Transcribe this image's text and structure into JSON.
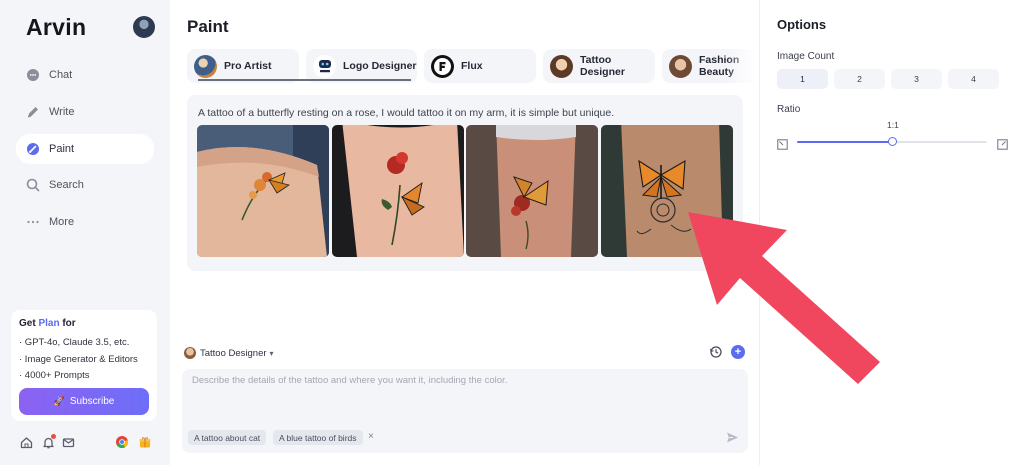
{
  "sidebar": {
    "brand": "Arvin",
    "nav": [
      {
        "label": "Chat",
        "icon": "chat-icon"
      },
      {
        "label": "Write",
        "icon": "write-icon"
      },
      {
        "label": "Paint",
        "icon": "paint-icon",
        "active": true
      },
      {
        "label": "Search",
        "icon": "search-icon"
      },
      {
        "label": "More",
        "icon": "more-icon"
      }
    ],
    "plan": {
      "title_prefix": "Get ",
      "title_accent": "Plan",
      "title_suffix": " for",
      "lines": [
        "· GPT-4o, Claude 3.5, etc.",
        "· Image Generator & Editors",
        "· 4000+ Prompts"
      ],
      "subscribe_label": "Subscribe"
    },
    "bottom_icons": [
      "home-icon",
      "notification-icon",
      "mail-icon",
      "chrome-icon",
      "gift-icon"
    ]
  },
  "main": {
    "title": "Paint",
    "tabs": [
      {
        "label": "Pro Artist"
      },
      {
        "label": "Logo Designer",
        "active": true
      },
      {
        "label": "Flux"
      },
      {
        "label": "Tattoo Designer"
      },
      {
        "label": "Fashion Beauty"
      }
    ],
    "result": {
      "prompt": "A tattoo of a butterfly resting on a rose, I would tattoo it on my arm, it is simple but unique.",
      "images": [
        "tattoo-image-1",
        "tattoo-image-2",
        "tattoo-image-3",
        "tattoo-image-4"
      ]
    },
    "composer": {
      "style": "Tattoo Designer",
      "placeholder": "Describe the details of the tattoo and where you want it, including the color.",
      "suggestions": [
        "A tattoo about cat",
        "A blue tattoo of birds"
      ]
    }
  },
  "options": {
    "title": "Options",
    "image_count_label": "Image Count",
    "image_counts": [
      "1",
      "2",
      "3",
      "4"
    ],
    "selected_count": "1",
    "ratio_label": "Ratio",
    "ratio_value": "1:1",
    "ratio_slider_fraction": 0.5
  },
  "colors": {
    "accent": "#5b6cf0",
    "sidebar_bg": "#f4f5f9",
    "annotation_arrow": "#f0475f"
  }
}
